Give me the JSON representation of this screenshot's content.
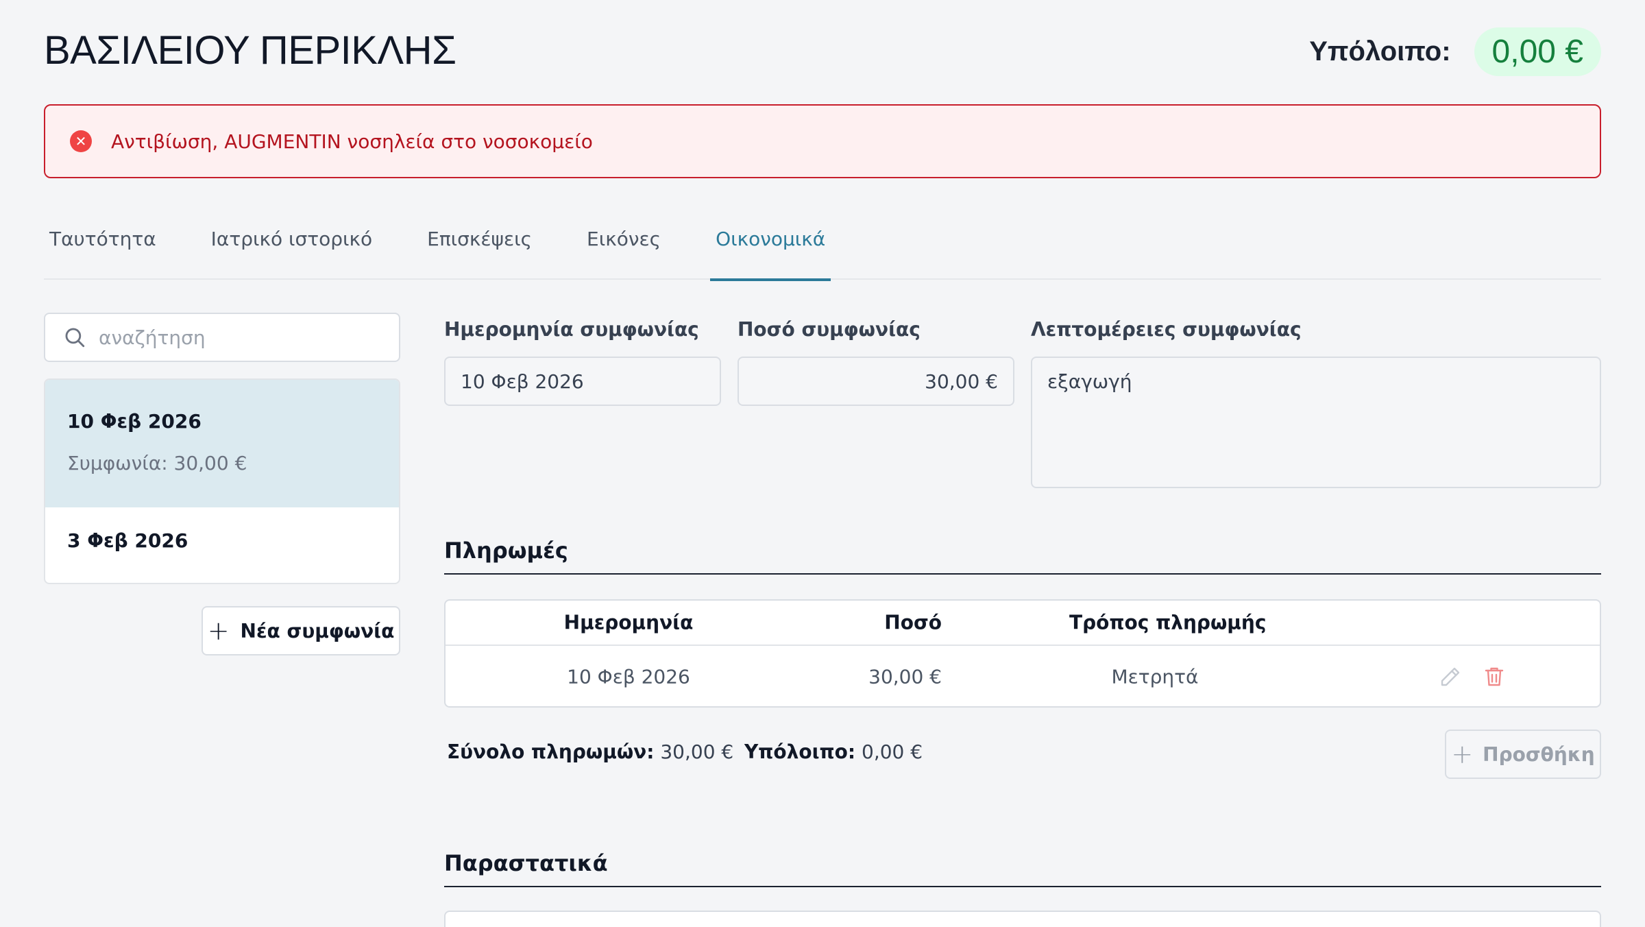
{
  "header": {
    "patient_name": "ΒΑΣΙΛΕΙΟΥ ΠΕΡΙΚΛΗΣ",
    "balance_label": "Υπόλοιπο:",
    "balance_value": "0,00 €"
  },
  "alert": {
    "icon": "x-circle-icon",
    "text": "Αντιβίωση, AUGMENTIN νοσηλεία στο νοσοκομείο"
  },
  "tabs": [
    {
      "label": "Ταυτότητα",
      "active": false
    },
    {
      "label": "Ιατρικό ιστορικό",
      "active": false
    },
    {
      "label": "Επισκέψεις",
      "active": false
    },
    {
      "label": "Εικόνες",
      "active": false
    },
    {
      "label": "Οικονομικά",
      "active": true
    }
  ],
  "sidebar": {
    "search_placeholder": "αναζήτηση",
    "agreements": [
      {
        "date": "10 Φεβ 2026",
        "amount": "Συμφωνία: 30,00 €",
        "selected": true
      },
      {
        "date": "3 Φεβ 2026",
        "selected": false
      }
    ],
    "new_agreement_label": "Νέα συμφωνία"
  },
  "form": {
    "date_label": "Ημερομηνία συμφωνίας",
    "date_value": "10 Φεβ 2026",
    "amount_label": "Ποσό συμφωνίας",
    "amount_value": "30,00 €",
    "details_label": "Λεπτομέρειες συμφωνίας",
    "details_value": "εξαγωγή"
  },
  "payments": {
    "title": "Πληρωμές",
    "columns": [
      "Ημερομηνία",
      "Ποσό",
      "Τρόπος πληρωμής"
    ],
    "rows": [
      {
        "date": "10 Φεβ 2026",
        "amount": "30,00 €",
        "method": "Μετρητά"
      }
    ],
    "total_label": "Σύνολο πληρωμών:",
    "total_value": "30,00 €",
    "balance_label": "Υπόλοιπο:",
    "balance_value": "0,00 €",
    "add_label": "Προσθήκη"
  },
  "documents": {
    "title": "Παραστατικά"
  },
  "colors": {
    "accent": "#2b7a99",
    "alert_border": "#c81e2c",
    "alert_bg": "#fef0f1",
    "balance_green": "#15803d",
    "balance_bg": "#dcfce7",
    "delete_red": "#ef4444"
  }
}
